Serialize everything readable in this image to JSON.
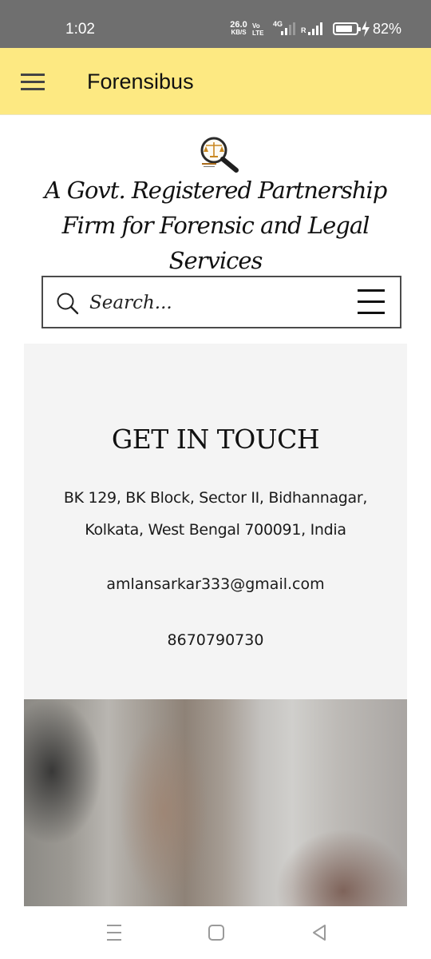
{
  "status_bar": {
    "time": "1:02",
    "net_speed": "26.0",
    "net_speed_unit": "KB/S",
    "volte_top": "Vo",
    "volte_bottom": "LTE",
    "network_type": "4G",
    "roaming": "R",
    "battery_percent": "82%",
    "battery_level": 0.82
  },
  "header": {
    "title": "Forensibus",
    "menu_icon": "hamburger-menu-icon",
    "background": "#fde982"
  },
  "hero": {
    "logo_icon": "magnifier-scales-logo",
    "tagline": "A Govt. Registered Partnership Firm for Forensic and Legal Services"
  },
  "search": {
    "placeholder": "Search...",
    "icon": "search-icon",
    "menu_icon": "menu-lines-icon"
  },
  "contact": {
    "heading": "GET IN TOUCH",
    "address_line1": "BK 129, BK Block, Sector II, Bidhannagar,",
    "address_line2": "Kolkata, West Bengal 700091, India",
    "email": "amlansarkar333@gmail.com",
    "phone": "8670790730"
  },
  "nav_bar": {
    "recents_icon": "recents-icon",
    "home_icon": "home-icon",
    "back_icon": "back-icon"
  }
}
